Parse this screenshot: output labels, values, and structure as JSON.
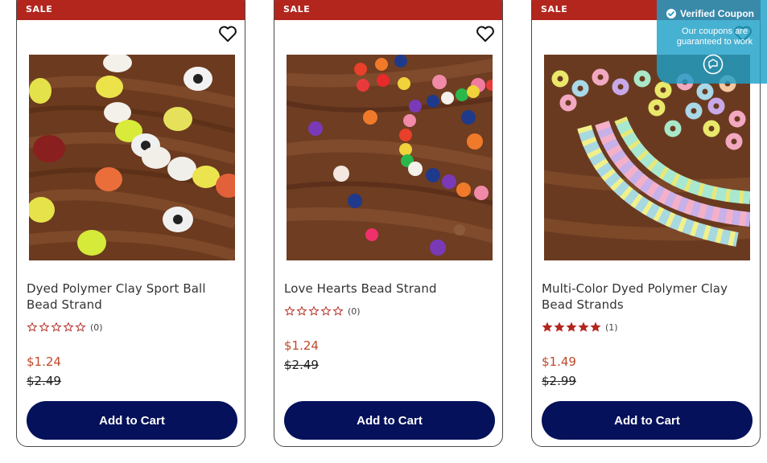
{
  "products": [
    {
      "badge": "SALE",
      "name": "Dyed Polymer Clay Sport Ball Bead Strand",
      "rating": 0,
      "review_count": "(0)",
      "price": "$1.24",
      "original_price": "$2.49",
      "cta": "Add to Cart"
    },
    {
      "badge": "SALE",
      "name": "Love Hearts Bead Strand",
      "rating": 0,
      "review_count": "(0)",
      "price": "$1.24",
      "original_price": "$2.49",
      "cta": "Add to Cart"
    },
    {
      "badge": "SALE",
      "name": "Multi-Color Dyed Polymer Clay Bead Strands",
      "rating": 5,
      "review_count": "(1)",
      "price": "$1.49",
      "original_price": "$2.99",
      "cta": "Add to Cart"
    }
  ],
  "coupon": {
    "title": "Verified Coupon",
    "description": "Our coupons are guaranteed to work"
  },
  "colors": {
    "sale_badge": "#b3261e",
    "cta_background": "#05115a",
    "price": "#c0492a",
    "star": "#b3261e",
    "coupon_overlay": "#1ea0c8"
  },
  "icons": {
    "wishlist": "heart-outline-icon",
    "rating": "star-icon",
    "verified": "check-circle-icon",
    "coupon": "chat-bubble-icon"
  }
}
